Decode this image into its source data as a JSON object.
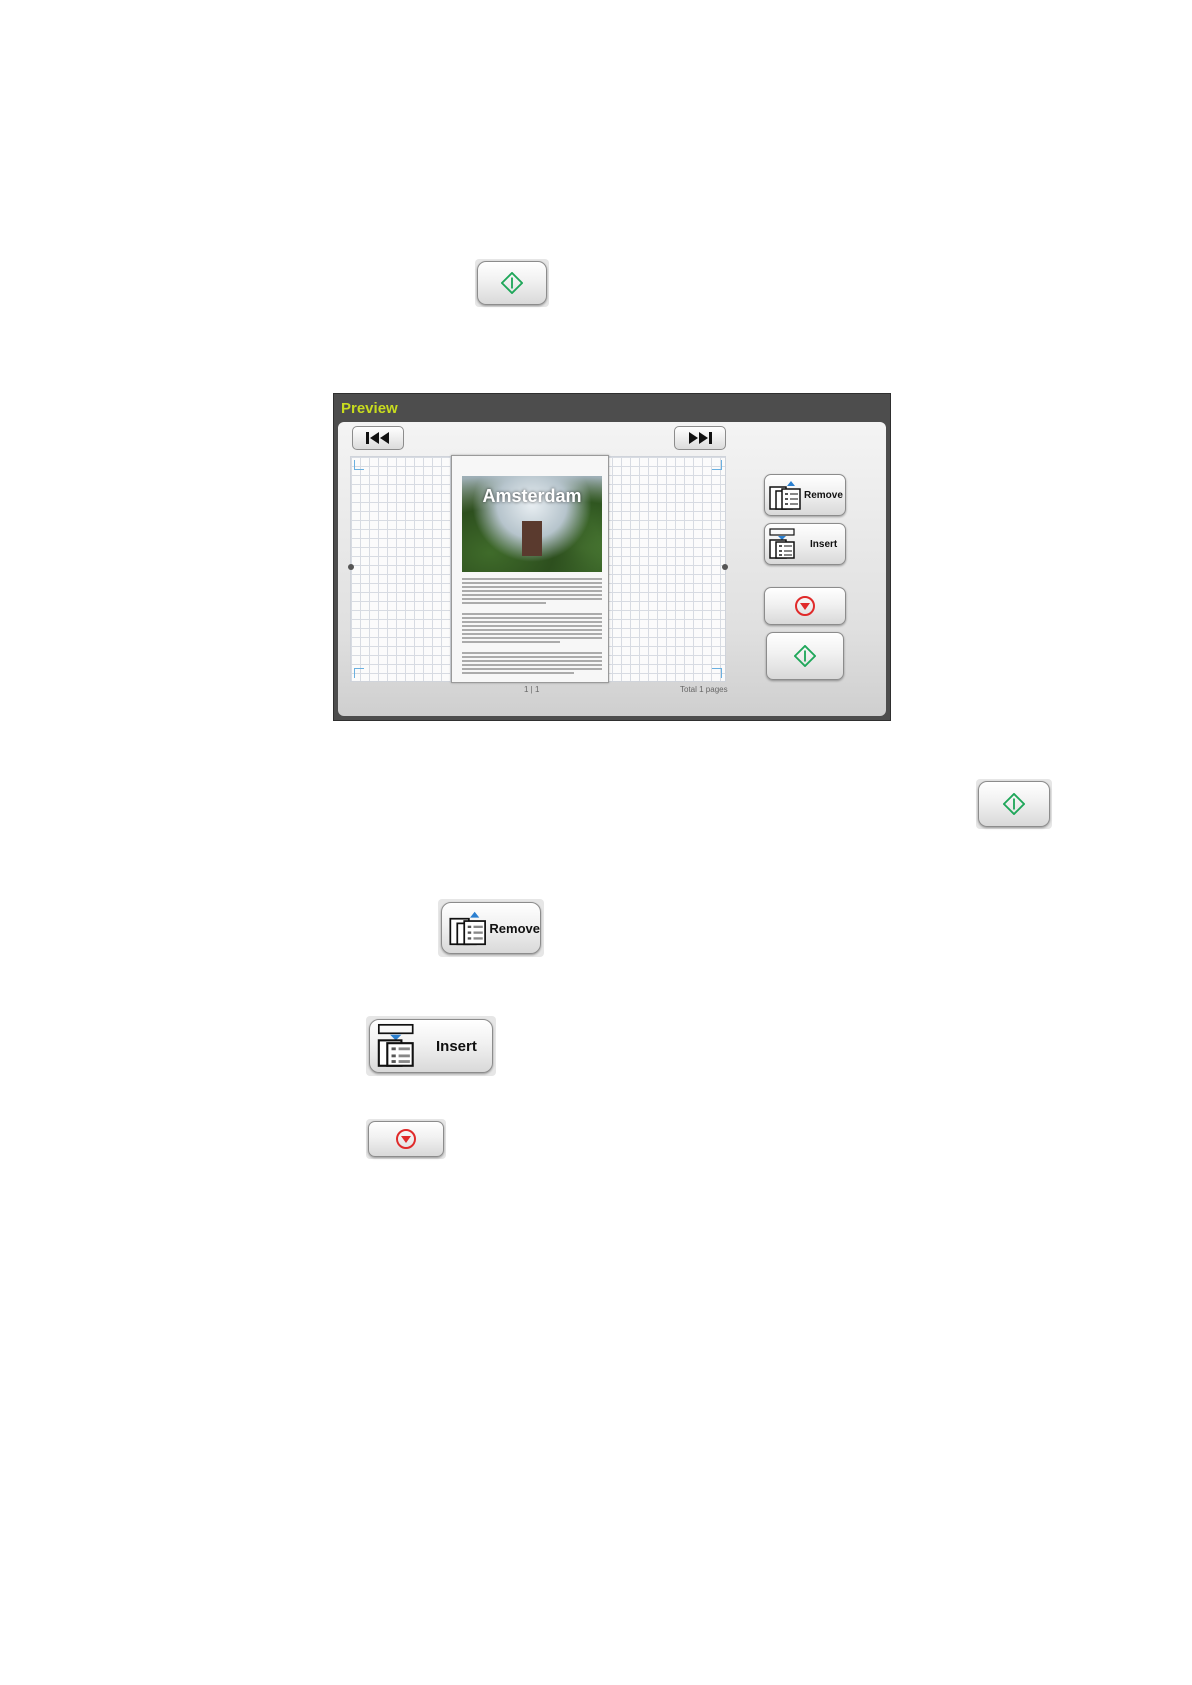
{
  "preview": {
    "title": "Preview",
    "document_title": "Amsterdam",
    "page_indicator": "1 | 1",
    "total_pages": "Total 1 pages",
    "remove_label": "Remove",
    "insert_label": "Insert"
  },
  "legend": {
    "remove_label": "Remove",
    "insert_label": "Insert"
  },
  "icons": {
    "start": "start-diamond-icon",
    "stop": "stop-down-triangle-icon",
    "first": "skip-first-icon",
    "last": "skip-last-icon",
    "remove": "remove-page-icon",
    "insert": "insert-page-icon"
  },
  "colors": {
    "start_green": "#1fa75a",
    "stop_red": "#e02a2a",
    "preview_title": "#c8dc1e"
  }
}
